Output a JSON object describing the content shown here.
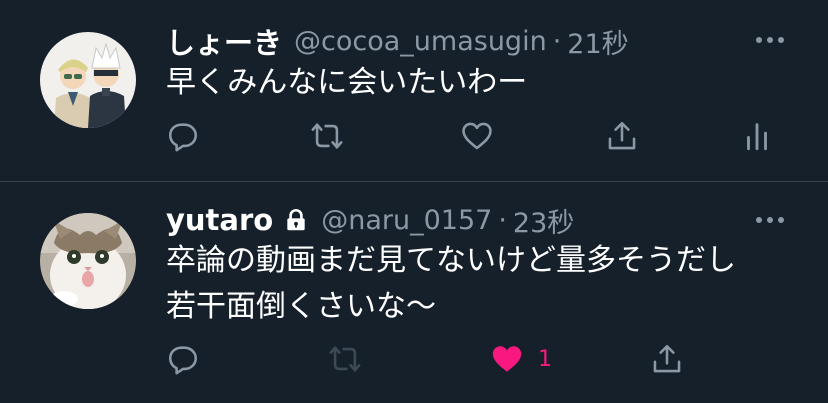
{
  "tweets": [
    {
      "display_name": "しょーき",
      "handle": "@cocoa_umasugin",
      "separator": "·",
      "time": "21秒",
      "text_lines": [
        "早くみんなに会いたいわー"
      ],
      "locked": false,
      "actions": [
        "reply-icon",
        "retweet-icon",
        "like-icon",
        "share-icon",
        "analytics-icon"
      ]
    },
    {
      "display_name": "yutaro",
      "handle": "@naru_0157",
      "separator": "·",
      "time": "23秒",
      "text_lines": [
        "卒論の動画まだ見てないけど量多そうだし",
        "若干面倒くさいな〜"
      ],
      "locked": true,
      "like_count": "1",
      "liked": true,
      "actions": [
        "reply-icon",
        "retweet-icon",
        "like-icon",
        "share-icon"
      ]
    }
  ],
  "colors": {
    "background": "#15202b",
    "divider": "#38444d",
    "secondary_text": "#8b98a5",
    "like_active": "#f91880",
    "retweet_disabled": "#3d4a55"
  }
}
